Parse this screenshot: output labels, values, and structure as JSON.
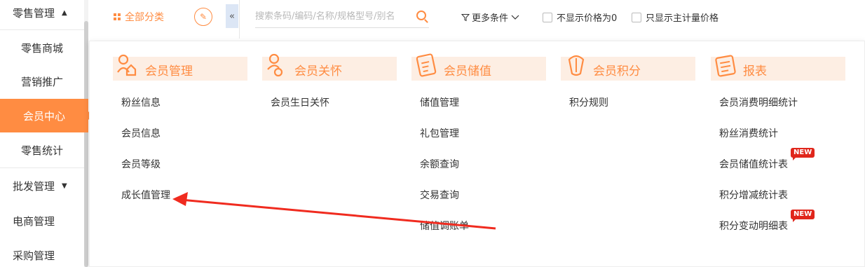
{
  "sidebar": {
    "retail_group": "零售管理",
    "items": [
      {
        "label": "零售商城"
      },
      {
        "label": "营销推广"
      },
      {
        "label": "会员中心"
      },
      {
        "label": "零售统计"
      }
    ],
    "wholesale_group": "批发管理",
    "ecommerce": "电商管理",
    "purchase": "采购管理"
  },
  "toolbar": {
    "category_label": "全部分类",
    "search_placeholder": "搜索条码/编码/名称/规格型号/别名",
    "more_conditions": "更多条件",
    "hide_zero_price": "不显示价格为0",
    "main_unit_price_only": "只显示主计量价格",
    "collapse_glyph": "«"
  },
  "menu": {
    "columns": [
      {
        "title": "会员管理",
        "icon": "member-management-icon",
        "items": [
          {
            "label": "粉丝信息"
          },
          {
            "label": "会员信息"
          },
          {
            "label": "会员等级"
          },
          {
            "label": "成长值管理"
          }
        ]
      },
      {
        "title": "会员关怀",
        "icon": "member-care-icon",
        "items": [
          {
            "label": "会员生日关怀"
          }
        ]
      },
      {
        "title": "会员储值",
        "icon": "member-stored-value-icon",
        "items": [
          {
            "label": "储值管理"
          },
          {
            "label": "礼包管理"
          },
          {
            "label": "余额查询"
          },
          {
            "label": "交易查询"
          },
          {
            "label": "储值调账单"
          }
        ]
      },
      {
        "title": "会员积分",
        "icon": "member-points-icon",
        "items": [
          {
            "label": "积分规则"
          }
        ]
      },
      {
        "title": "报表",
        "icon": "report-icon",
        "items": [
          {
            "label": "会员消费明细统计"
          },
          {
            "label": "粉丝消费统计"
          },
          {
            "label": "会员储值统计表",
            "badge": "NEW"
          },
          {
            "label": "积分增减统计表"
          },
          {
            "label": "积分变动明细表",
            "badge": "NEW"
          }
        ]
      }
    ]
  },
  "colors": {
    "accent": "#ff8c42",
    "header_bg": "#fdeee3",
    "badge_red": "#e0261b",
    "annotation_arrow": "#f02b1f"
  }
}
